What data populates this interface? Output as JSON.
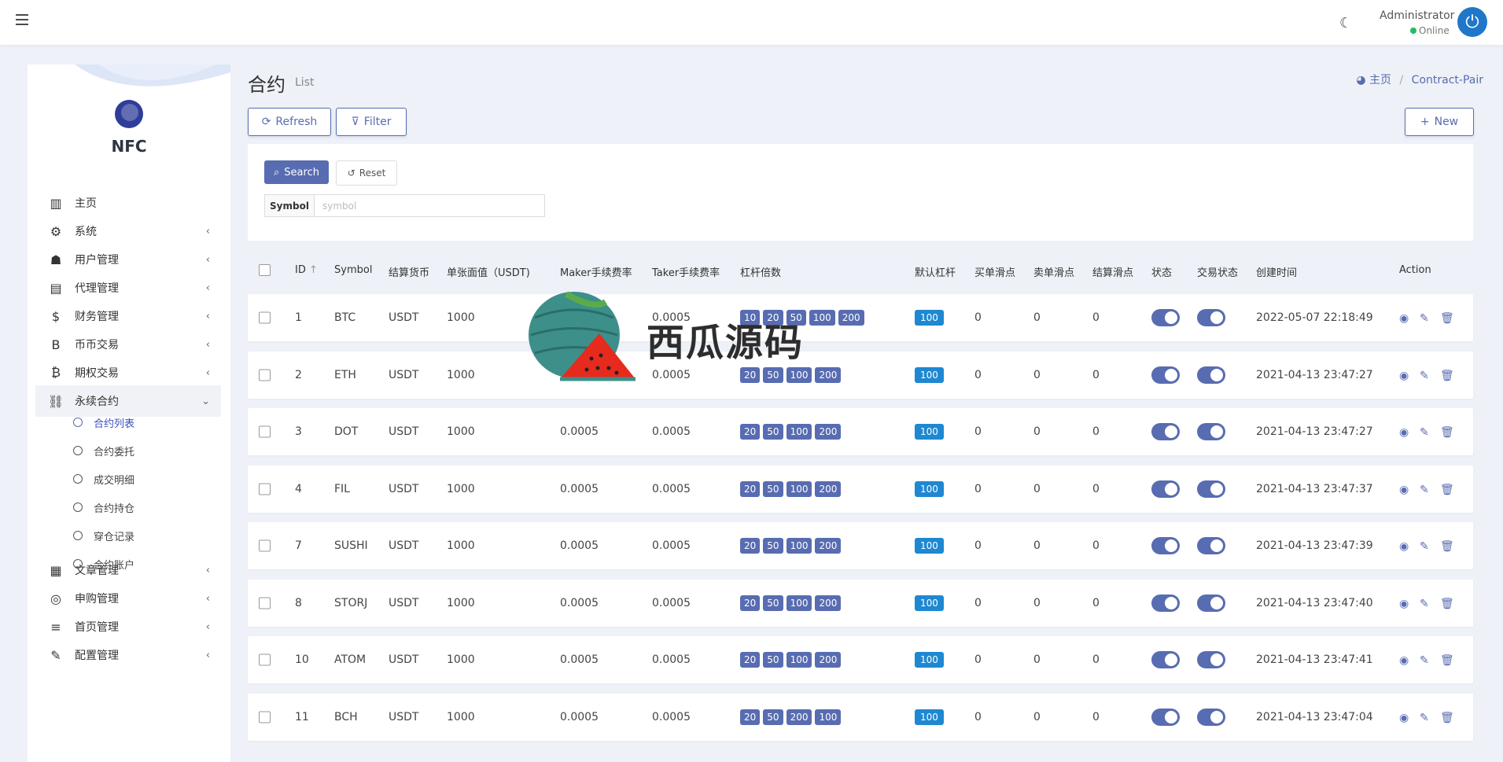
{
  "header": {
    "user_name": "Administrator",
    "user_status": "Online"
  },
  "sidebar": {
    "brand": "NFC",
    "items": [
      {
        "label": "主页",
        "icon": "bar-chart-icon",
        "has_children": false
      },
      {
        "label": "系统",
        "icon": "gear-icon",
        "has_children": true
      },
      {
        "label": "用户管理",
        "icon": "user-icon",
        "has_children": true
      },
      {
        "label": "代理管理",
        "icon": "id-card-icon",
        "has_children": true
      },
      {
        "label": "财务管理",
        "icon": "dollar-icon",
        "has_children": true
      },
      {
        "label": "币币交易",
        "icon": "bitcoin-b-icon",
        "has_children": true
      },
      {
        "label": "期权交易",
        "icon": "bitcoin-icon",
        "has_children": true
      },
      {
        "label": "永续合约",
        "icon": "link-icon",
        "has_children": true,
        "expanded": true
      },
      {
        "label": "文章管理",
        "icon": "newspaper-icon",
        "has_children": true
      },
      {
        "label": "申购管理",
        "icon": "life-ring-icon",
        "has_children": true
      },
      {
        "label": "首页管理",
        "icon": "list-icon",
        "has_children": true
      },
      {
        "label": "配置管理",
        "icon": "wrench-icon",
        "has_children": true
      }
    ],
    "sub_items": [
      {
        "label": "合约列表",
        "active": true
      },
      {
        "label": "合约委托",
        "active": false
      },
      {
        "label": "成交明细",
        "active": false
      },
      {
        "label": "合约持仓",
        "active": false
      },
      {
        "label": "穿仓记录",
        "active": false
      },
      {
        "label": "合约账户",
        "active": false
      }
    ]
  },
  "page": {
    "title": "合约",
    "subtitle": "List",
    "breadcrumb_home": "主页",
    "breadcrumb_current": "Contract-Pair"
  },
  "toolbar": {
    "refresh_label": "Refresh",
    "filter_label": "Filter",
    "new_label": "New"
  },
  "filter": {
    "search_label": "Search",
    "reset_label": "Reset",
    "symbol_label": "Symbol",
    "symbol_placeholder": "symbol"
  },
  "table": {
    "columns": [
      "ID",
      "Symbol",
      "结算货币",
      "单张面值（USDT)",
      "Maker手续费率",
      "Taker手续费率",
      "杠杆倍数",
      "默认杠杆",
      "买单滑点",
      "卖单滑点",
      "结算滑点",
      "状态",
      "交易状态",
      "创建时间",
      "Action"
    ],
    "rows": [
      {
        "id": "1",
        "symbol": "BTC",
        "currency": "USDT",
        "face_value": "1000",
        "maker": "",
        "taker": "0.0005",
        "leverage": [
          "10",
          "20",
          "50",
          "100",
          "200"
        ],
        "default_lev": "100",
        "buy_slip": "0",
        "sell_slip": "0",
        "settle_slip": "0",
        "created": "2022-05-07 22:18:49"
      },
      {
        "id": "2",
        "symbol": "ETH",
        "currency": "USDT",
        "face_value": "1000",
        "maker": "0",
        "taker": "0.0005",
        "leverage": [
          "20",
          "50",
          "100",
          "200"
        ],
        "default_lev": "100",
        "buy_slip": "0",
        "sell_slip": "0",
        "settle_slip": "0",
        "created": "2021-04-13 23:47:27"
      },
      {
        "id": "3",
        "symbol": "DOT",
        "currency": "USDT",
        "face_value": "1000",
        "maker": "0.0005",
        "taker": "0.0005",
        "leverage": [
          "20",
          "50",
          "100",
          "200"
        ],
        "default_lev": "100",
        "buy_slip": "0",
        "sell_slip": "0",
        "settle_slip": "0",
        "created": "2021-04-13 23:47:27"
      },
      {
        "id": "4",
        "symbol": "FIL",
        "currency": "USDT",
        "face_value": "1000",
        "maker": "0.0005",
        "taker": "0.0005",
        "leverage": [
          "20",
          "50",
          "100",
          "200"
        ],
        "default_lev": "100",
        "buy_slip": "0",
        "sell_slip": "0",
        "settle_slip": "0",
        "created": "2021-04-13 23:47:37"
      },
      {
        "id": "7",
        "symbol": "SUSHI",
        "currency": "USDT",
        "face_value": "1000",
        "maker": "0.0005",
        "taker": "0.0005",
        "leverage": [
          "20",
          "50",
          "100",
          "200"
        ],
        "default_lev": "100",
        "buy_slip": "0",
        "sell_slip": "0",
        "settle_slip": "0",
        "created": "2021-04-13 23:47:39"
      },
      {
        "id": "8",
        "symbol": "STORJ",
        "currency": "USDT",
        "face_value": "1000",
        "maker": "0.0005",
        "taker": "0.0005",
        "leverage": [
          "20",
          "50",
          "100",
          "200"
        ],
        "default_lev": "100",
        "buy_slip": "0",
        "sell_slip": "0",
        "settle_slip": "0",
        "created": "2021-04-13 23:47:40"
      },
      {
        "id": "10",
        "symbol": "ATOM",
        "currency": "USDT",
        "face_value": "1000",
        "maker": "0.0005",
        "taker": "0.0005",
        "leverage": [
          "20",
          "50",
          "100",
          "200"
        ],
        "default_lev": "100",
        "buy_slip": "0",
        "sell_slip": "0",
        "settle_slip": "0",
        "created": "2021-04-13 23:47:41"
      },
      {
        "id": "11",
        "symbol": "BCH",
        "currency": "USDT",
        "face_value": "1000",
        "maker": "0.0005",
        "taker": "0.0005",
        "leverage": [
          "20",
          "50",
          "200",
          "100"
        ],
        "default_lev": "100",
        "buy_slip": "0",
        "sell_slip": "0",
        "settle_slip": "0",
        "created": "2021-04-13 23:47:04"
      }
    ]
  },
  "watermark": {
    "text": "西瓜源码"
  },
  "colors": {
    "accent": "#586cb1",
    "default_badge": "#1e88d2",
    "online": "#1fbf5f",
    "background": "#eef1f7"
  }
}
